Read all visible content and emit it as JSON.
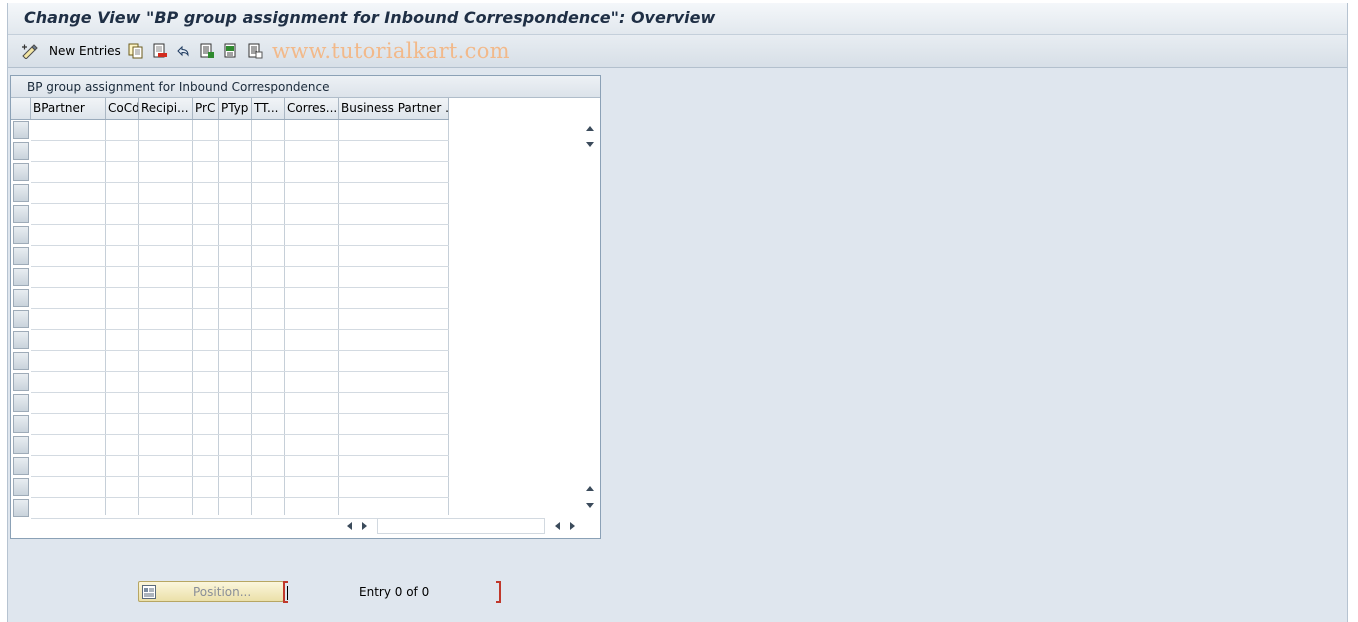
{
  "window": {
    "title": "Change View \"BP group assignment for Inbound Correspondence\": Overview"
  },
  "toolbar": {
    "new_entries_label": "New Entries",
    "watermark": "www.tutorialkart.com"
  },
  "table": {
    "title": "BP group assignment for Inbound Correspondence",
    "columns": [
      "BPartner",
      "CoCd",
      "Recipi...",
      "PrC",
      "PTyp",
      "TT...",
      "Corres...",
      "Business Partner ..."
    ],
    "visible_row_count": 19,
    "rows": []
  },
  "footer": {
    "position_label": "Position...",
    "entry_status": "Entry 0 of 0"
  },
  "colors": {
    "background": "#dfe6ee",
    "title_text": "#1f2f45",
    "watermark": "#f2b98a",
    "marker": "#c0382b"
  }
}
